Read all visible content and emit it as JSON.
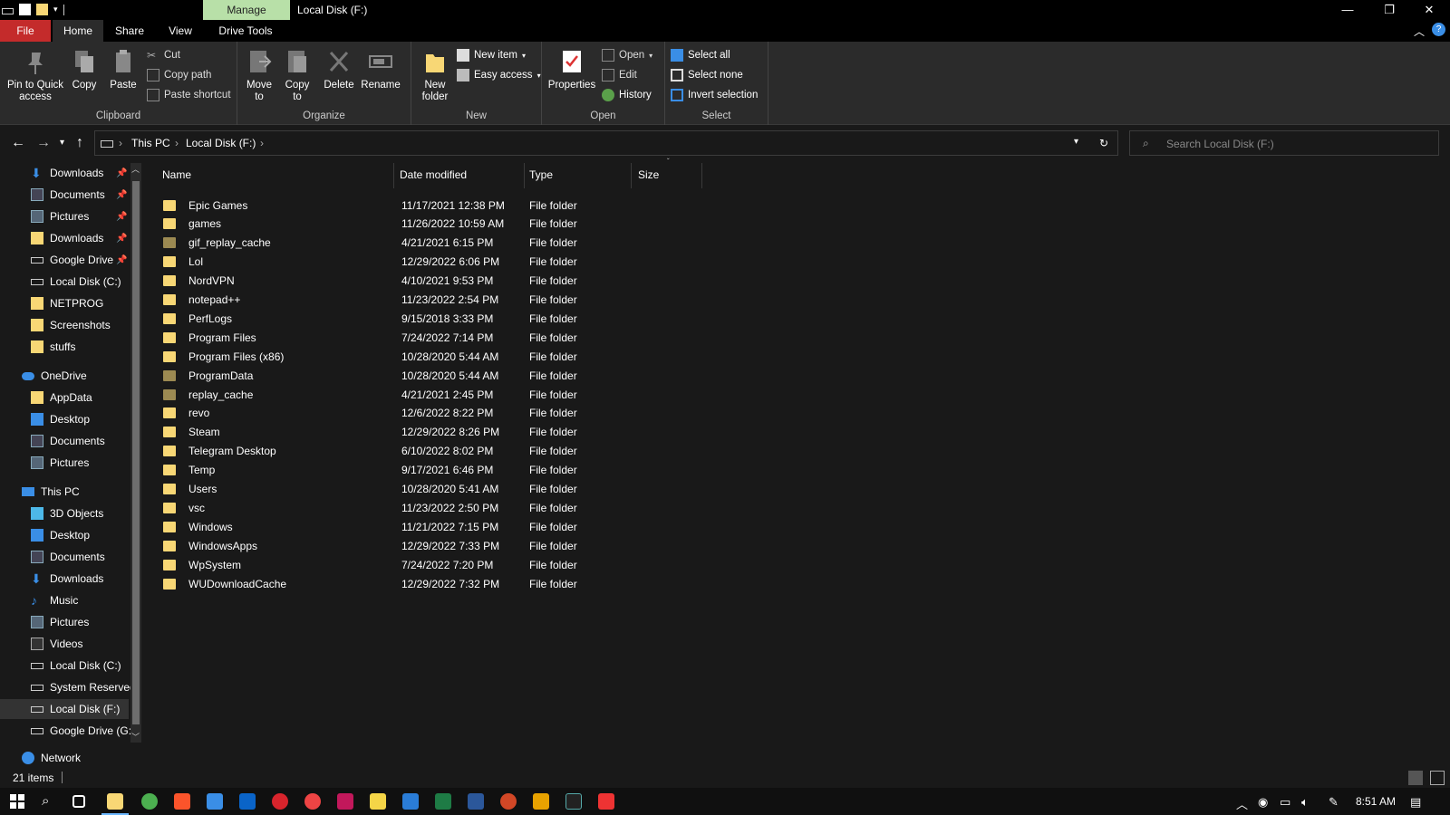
{
  "window": {
    "title": "Local Disk (F:)",
    "manage_tab": "Manage",
    "controls": {
      "minimize": "—",
      "restore": "❐",
      "close": "✕"
    }
  },
  "ribbon_tabs": {
    "file": "File",
    "home": "Home",
    "share": "Share",
    "view": "View",
    "drive_tools": "Drive Tools"
  },
  "ribbon": {
    "clipboard": {
      "label": "Clipboard",
      "pin": "Pin to Quick access",
      "copy": "Copy",
      "paste": "Paste",
      "cut": "Cut",
      "copy_path": "Copy path",
      "paste_shortcut": "Paste shortcut"
    },
    "organize": {
      "label": "Organize",
      "move_to": "Move to",
      "copy_to": "Copy to",
      "delete": "Delete",
      "rename": "Rename"
    },
    "new": {
      "label": "New",
      "new_folder": "New folder",
      "new_item": "New item",
      "easy_access": "Easy access"
    },
    "open": {
      "label": "Open",
      "properties": "Properties",
      "open": "Open",
      "edit": "Edit",
      "history": "History"
    },
    "select": {
      "label": "Select",
      "select_all": "Select all",
      "select_none": "Select none",
      "invert": "Invert selection"
    }
  },
  "address": {
    "this_pc": "This PC",
    "drive": "Local Disk (F:)",
    "search_placeholder": "Search Local Disk (F:)"
  },
  "nav": {
    "quick_access": [
      {
        "label": "Downloads",
        "icon": "download-arrow-icon",
        "pinned": true
      },
      {
        "label": "Documents",
        "icon": "documents-icon",
        "pinned": true
      },
      {
        "label": "Pictures",
        "icon": "pictures-icon",
        "pinned": true
      },
      {
        "label": "Downloads",
        "icon": "folder-icon",
        "pinned": true
      },
      {
        "label": "Google Drive",
        "icon": "drive-icon",
        "pinned": true
      },
      {
        "label": "Local Disk (C:)",
        "icon": "drive-icon",
        "pinned": false
      },
      {
        "label": "NETPROG",
        "icon": "folder-icon",
        "pinned": false
      },
      {
        "label": "Screenshots",
        "icon": "folder-icon",
        "pinned": false
      },
      {
        "label": "stuffs",
        "icon": "folder-icon",
        "pinned": false
      }
    ],
    "onedrive": {
      "label": "OneDrive",
      "items": [
        "AppData",
        "Desktop",
        "Documents",
        "Pictures"
      ]
    },
    "this_pc": {
      "label": "This PC",
      "items": [
        "3D Objects",
        "Desktop",
        "Documents",
        "Downloads",
        "Music",
        "Pictures",
        "Videos",
        "Local Disk (C:)",
        "System Reserved",
        "Local Disk (F:)",
        "Google Drive (G:)"
      ]
    },
    "network": "Network"
  },
  "columns": {
    "name": "Name",
    "date": "Date modified",
    "type": "Type",
    "size": "Size"
  },
  "files": [
    {
      "name": "Epic Games",
      "date": "11/17/2021 12:38 PM",
      "type": "File folder",
      "dim": false
    },
    {
      "name": "games",
      "date": "11/26/2022 10:59 AM",
      "type": "File folder",
      "dim": false
    },
    {
      "name": "gif_replay_cache",
      "date": "4/21/2021 6:15 PM",
      "type": "File folder",
      "dim": true
    },
    {
      "name": "Lol",
      "date": "12/29/2022 6:06 PM",
      "type": "File folder",
      "dim": false
    },
    {
      "name": "NordVPN",
      "date": "4/10/2021 9:53 PM",
      "type": "File folder",
      "dim": false
    },
    {
      "name": "notepad++",
      "date": "11/23/2022 2:54 PM",
      "type": "File folder",
      "dim": false
    },
    {
      "name": "PerfLogs",
      "date": "9/15/2018 3:33 PM",
      "type": "File folder",
      "dim": false
    },
    {
      "name": "Program Files",
      "date": "7/24/2022 7:14 PM",
      "type": "File folder",
      "dim": false
    },
    {
      "name": "Program Files (x86)",
      "date": "10/28/2020 5:44 AM",
      "type": "File folder",
      "dim": false
    },
    {
      "name": "ProgramData",
      "date": "10/28/2020 5:44 AM",
      "type": "File folder",
      "dim": true
    },
    {
      "name": "replay_cache",
      "date": "4/21/2021 2:45 PM",
      "type": "File folder",
      "dim": true
    },
    {
      "name": "revo",
      "date": "12/6/2022 8:22 PM",
      "type": "File folder",
      "dim": false
    },
    {
      "name": "Steam",
      "date": "12/29/2022 8:26 PM",
      "type": "File folder",
      "dim": false
    },
    {
      "name": "Telegram Desktop",
      "date": "6/10/2022 8:02 PM",
      "type": "File folder",
      "dim": false
    },
    {
      "name": "Temp",
      "date": "9/17/2021 6:46 PM",
      "type": "File folder",
      "dim": false
    },
    {
      "name": "Users",
      "date": "10/28/2020 5:41 AM",
      "type": "File folder",
      "dim": false
    },
    {
      "name": "vsc",
      "date": "11/23/2022 2:50 PM",
      "type": "File folder",
      "dim": false
    },
    {
      "name": "Windows",
      "date": "11/21/2022 7:15 PM",
      "type": "File folder",
      "dim": false
    },
    {
      "name": "WindowsApps",
      "date": "12/29/2022 7:33 PM",
      "type": "File folder",
      "dim": false
    },
    {
      "name": "WpSystem",
      "date": "7/24/2022 7:20 PM",
      "type": "File folder",
      "dim": false
    },
    {
      "name": "WUDownloadCache",
      "date": "12/29/2022 7:32 PM",
      "type": "File folder",
      "dim": false
    }
  ],
  "status": {
    "count": "21 items"
  },
  "taskbar": {
    "time": "8:51 AM"
  },
  "colors": {
    "folder": "#f8d775",
    "folder_dim": "#9c8a52",
    "file_tab": "#c42b2b",
    "manage": "#b8e0a8",
    "accent": "#3a8ee6"
  }
}
